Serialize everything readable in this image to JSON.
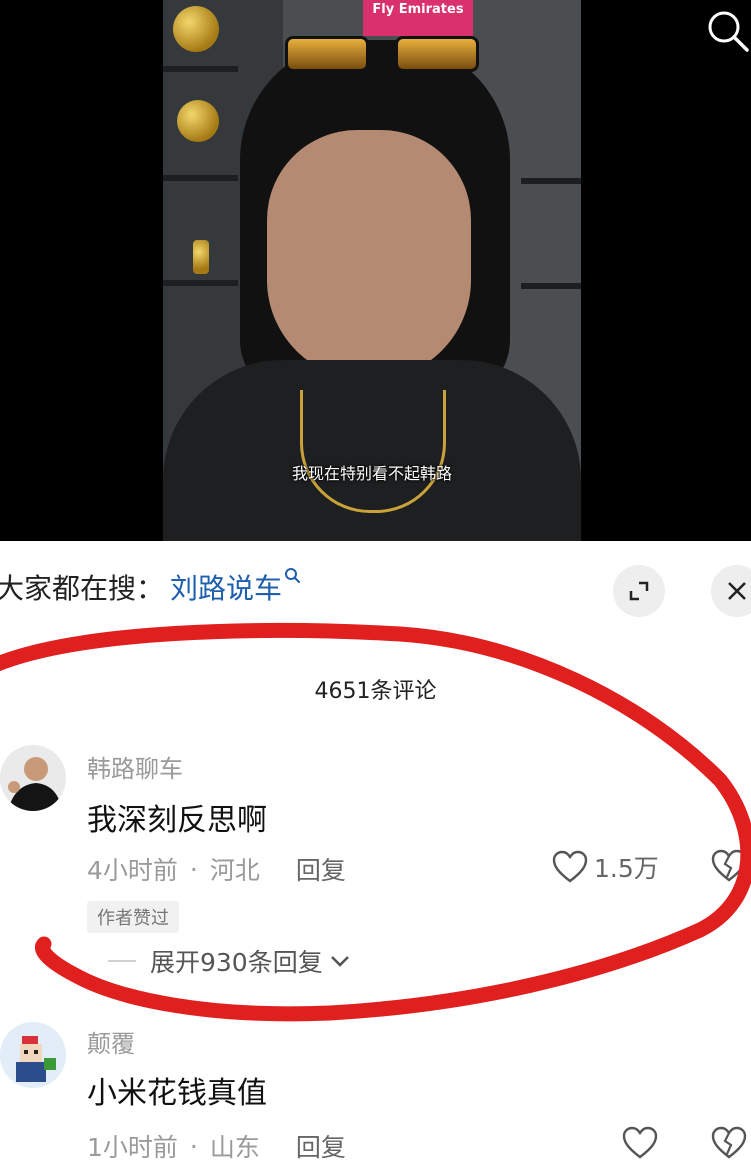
{
  "video": {
    "sign_text": "Fly Emirates",
    "subtitle": "我现在特别看不起韩路"
  },
  "hot_search": {
    "prefix": "大家都在搜：",
    "term": "刘路说车"
  },
  "comments_count": "4651条评论",
  "comments": [
    {
      "author": "韩路聊车",
      "text": "我深刻反思啊",
      "time": "4小时前",
      "location": "河北",
      "reply_label": "回复",
      "likes": "1.5万",
      "badge": "作者赞过",
      "expand_label": "展开930条回复"
    },
    {
      "author": "颠覆",
      "text": "小米花钱真值",
      "time": "1小时前",
      "location": "山东",
      "reply_label": "回复",
      "likes": ""
    }
  ],
  "colors": {
    "link": "#1e5fae",
    "annotation": "#e0201f",
    "meta": "#9a9a9a"
  }
}
